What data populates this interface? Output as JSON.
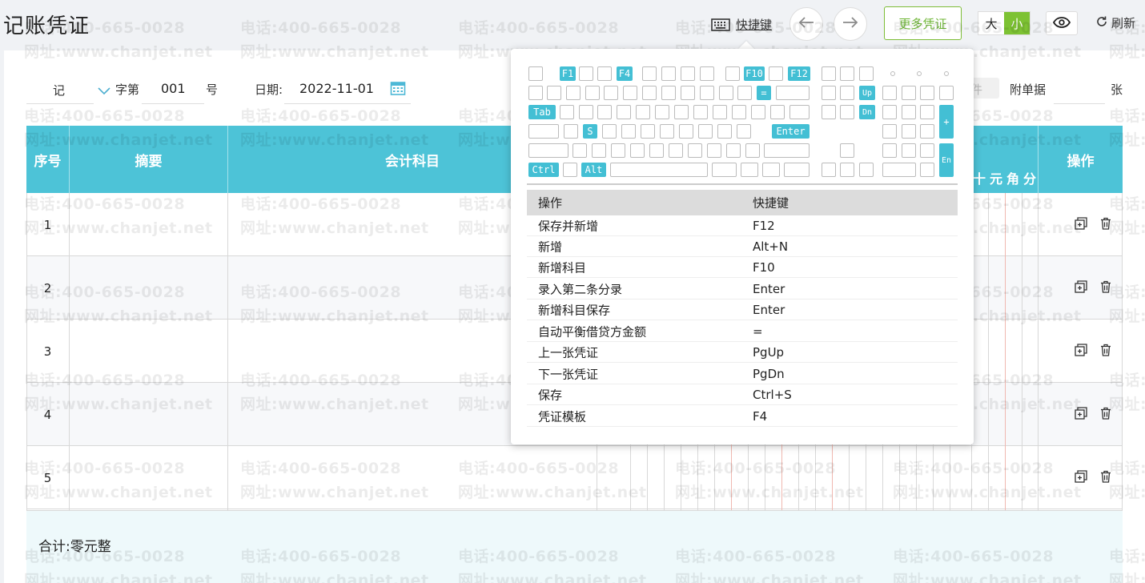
{
  "page_title": "记账凭证",
  "toolbar": {
    "shortcut_label": "快捷键",
    "more_label": "更多凭证",
    "size_large": "大",
    "size_small": "小",
    "refresh_label": "刷新"
  },
  "voucher_header": {
    "type_label": "记",
    "word_label": "字第",
    "number": "001",
    "number_suffix": "号",
    "date_label": "日期:",
    "date_value": "2022-11-01",
    "attach_partial": "件",
    "attach_label": "附单据",
    "attach_unit": "张"
  },
  "table": {
    "headers": {
      "index": "序号",
      "summary": "摘要",
      "account": "会计科目",
      "actions": "操作"
    },
    "money_units": [
      "十",
      "元",
      "角",
      "分"
    ],
    "rows": [
      {
        "index": "1"
      },
      {
        "index": "2"
      },
      {
        "index": "3"
      },
      {
        "index": "4"
      },
      {
        "index": "5"
      }
    ],
    "total_label": "合计:零元整"
  },
  "watermark": {
    "phone": "电话:400-665-0028",
    "site": "网址:www.chanjet.net"
  },
  "shortcut_popup": {
    "keys": {
      "f1": "F1",
      "f4": "F4",
      "f10": "F10",
      "f12": "F12",
      "eq": "=",
      "up": "Up",
      "dn": "Dn",
      "tab": "Tab",
      "s": "S",
      "enter": "Enter",
      "plus": "+",
      "en": "En",
      "ctrl": "Ctrl",
      "alt": "Alt"
    },
    "header": {
      "action": "操作",
      "key": "快捷键"
    },
    "rows": [
      {
        "action": "保存并新增",
        "key": "F12"
      },
      {
        "action": "新增",
        "key": "Alt+N"
      },
      {
        "action": "新增科目",
        "key": "F10"
      },
      {
        "action": "录入第二条分录",
        "key": "Enter"
      },
      {
        "action": "新增科目保存",
        "key": "Enter"
      },
      {
        "action": "自动平衡借贷方金额",
        "key": "="
      },
      {
        "action": "上一张凭证",
        "key": "PgUp"
      },
      {
        "action": "下一张凭证",
        "key": "PgDn"
      },
      {
        "action": "保存",
        "key": "Ctrl+S"
      },
      {
        "action": "凭证模板",
        "key": "F4"
      }
    ]
  }
}
